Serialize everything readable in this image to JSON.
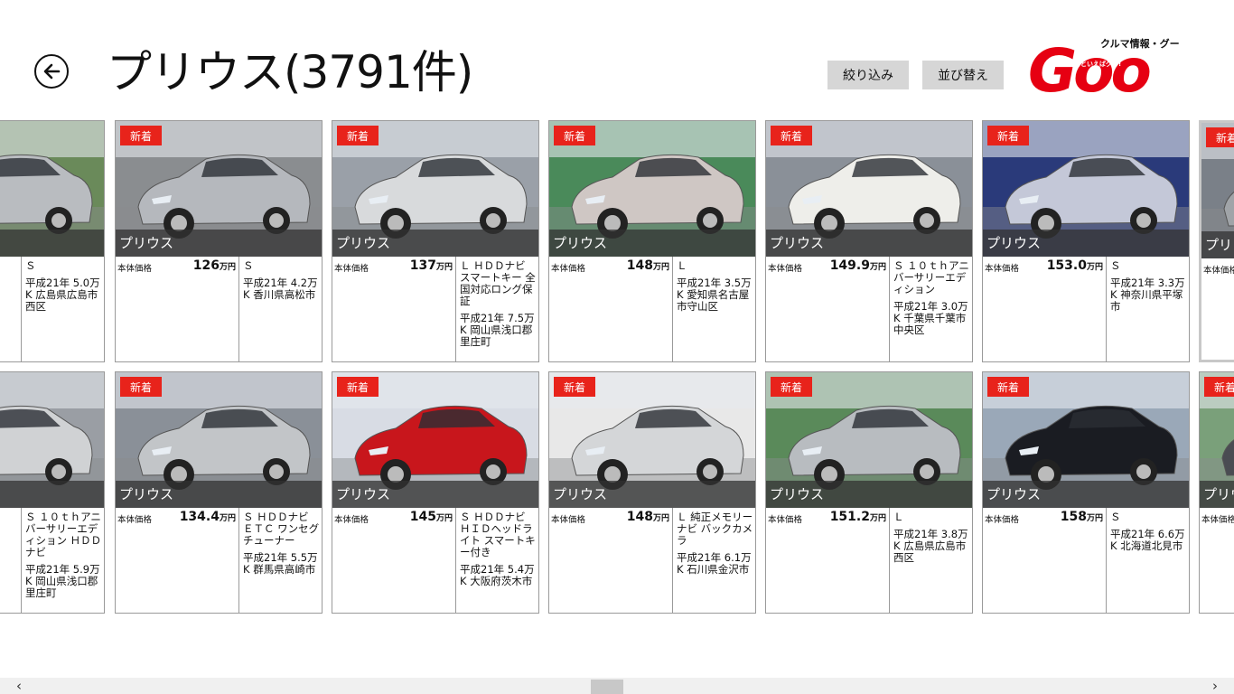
{
  "header": {
    "title": "プリウス(3791件)",
    "filter_label": "絞り込み",
    "sort_label": "並び替え"
  },
  "logo": {
    "tagline": "クルマ情報・グー",
    "wordmark": "Goo",
    "sub": "カーといえばグー!",
    "color": "#e60012"
  },
  "common": {
    "badge": "新着",
    "model": "プリウス",
    "price_label": "本体価格",
    "unit": "万円",
    "badge_color": "#e8231b"
  },
  "cards_row1": [
    {
      "price": "",
      "grade": "Ｓ",
      "meta": "平成21年 5.0万K 広島県広島市西区",
      "badge": false,
      "car": "#b9bcc0",
      "bg": "#6a8a5a"
    },
    {
      "price": "126",
      "grade": "Ｓ",
      "meta": "平成21年 4.2万K 香川県高松市",
      "badge": true,
      "car": "#b5b8bd",
      "bg": "#8a8d90"
    },
    {
      "price": "137",
      "grade": "Ｌ ＨＤＤナビ スマートキー 全国対応ロング保証",
      "meta": "平成21年 7.5万K 岡山県浅口郡里庄町",
      "badge": true,
      "car": "#d8dadc",
      "bg": "#9aa0a8"
    },
    {
      "price": "148",
      "grade": "Ｌ",
      "meta": "平成21年 3.5万K 愛知県名古屋市守山区",
      "badge": true,
      "car": "#cfc7c4",
      "bg": "#4a8a5a"
    },
    {
      "price": "149.9",
      "grade": "Ｓ １０ｔｈアニバーサリーエディション",
      "meta": "平成21年 3.0万K 千葉県千葉市中央区",
      "badge": true,
      "car": "#eeeeea",
      "bg": "#8a9098"
    },
    {
      "price": "153.0",
      "grade": "Ｓ",
      "meta": "平成21年 3.3万K 神奈川県平塚市",
      "badge": true,
      "car": "#c4c8d8",
      "bg": "#2a3a7a"
    },
    {
      "price": "",
      "grade": "",
      "meta": "",
      "badge": true,
      "car": "#a0a4a8",
      "bg": "#7a8088"
    }
  ],
  "cards_row2": [
    {
      "price": "",
      "grade": "Ｓ １０ｔｈアニバーサリーエディション ＨＤＤナビ",
      "meta": "平成21年 5.9万K 岡山県浅口郡里庄町",
      "badge": false,
      "car": "#d0d2d4",
      "bg": "#9a9ea4"
    },
    {
      "price": "134.4",
      "grade": "Ｓ ＨＤＤナビ ＥＴＣ ワンセグチューナー",
      "meta": "平成21年 5.5万K 群馬県高崎市",
      "badge": true,
      "car": "#c2c5c8",
      "bg": "#8a9098"
    },
    {
      "price": "145",
      "grade": "Ｓ ＨＤＤナビ ＨＩＤヘッドライト スマートキー付き",
      "meta": "平成21年 5.4万K 大阪府茨木市",
      "badge": true,
      "car": "#c8161c",
      "bg": "#d8dce4"
    },
    {
      "price": "148",
      "grade": "Ｌ 純正メモリーナビ バックカメラ",
      "meta": "平成21年 6.1万K 石川県金沢市",
      "badge": true,
      "car": "#d4d6d8",
      "bg": "#e8e8e8"
    },
    {
      "price": "151.2",
      "grade": "Ｌ",
      "meta": "平成21年 3.8万K 広島県広島市西区",
      "badge": true,
      "car": "#b8bcc0",
      "bg": "#5a8a5a"
    },
    {
      "price": "158",
      "grade": "Ｓ",
      "meta": "平成21年 6.6万K 北海道北見市",
      "badge": true,
      "car": "#1a1c22",
      "bg": "#9aa8b8"
    },
    {
      "price": "",
      "grade": "",
      "meta": "",
      "badge": true,
      "car": "#4a4c52",
      "bg": "#7aa07a"
    }
  ],
  "scrollbar": {
    "left": "‹",
    "right": "›"
  }
}
